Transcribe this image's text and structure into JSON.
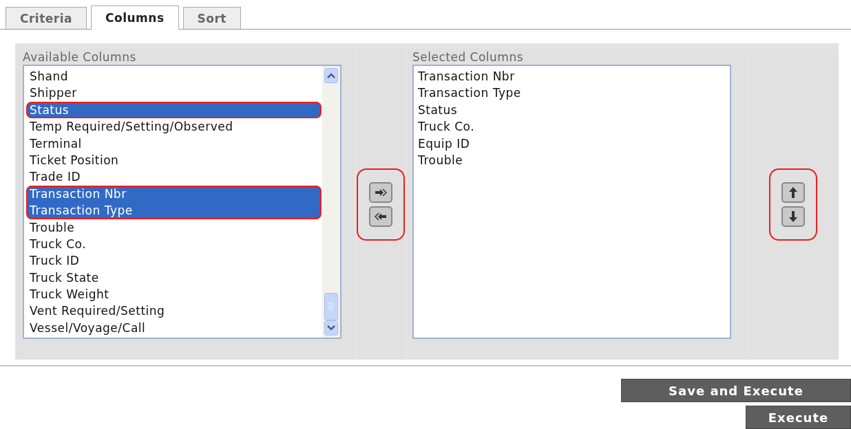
{
  "tabs": [
    {
      "label": "Criteria",
      "selected": false
    },
    {
      "label": "Columns",
      "selected": true
    },
    {
      "label": "Sort",
      "selected": false
    }
  ],
  "available": {
    "label": "Available Columns",
    "items": [
      {
        "label": "Shand",
        "selected": false,
        "circled": false
      },
      {
        "label": "Shipper",
        "selected": false,
        "circled": false
      },
      {
        "label": "Status",
        "selected": true,
        "circled": true
      },
      {
        "label": "Temp Required/Setting/Observed",
        "selected": false,
        "circled": false
      },
      {
        "label": "Terminal",
        "selected": false,
        "circled": false
      },
      {
        "label": "Ticket Position",
        "selected": false,
        "circled": false
      },
      {
        "label": "Trade ID",
        "selected": false,
        "circled": false
      },
      {
        "label": "Transaction Nbr",
        "selected": true,
        "circled": true
      },
      {
        "label": "Transaction Type",
        "selected": true,
        "circled": true
      },
      {
        "label": "Trouble",
        "selected": false,
        "circled": false
      },
      {
        "label": "Truck Co.",
        "selected": false,
        "circled": false
      },
      {
        "label": "Truck ID",
        "selected": false,
        "circled": false
      },
      {
        "label": "Truck State",
        "selected": false,
        "circled": false
      },
      {
        "label": "Truck Weight",
        "selected": false,
        "circled": false
      },
      {
        "label": "Vent Required/Setting",
        "selected": false,
        "circled": false
      },
      {
        "label": "Vessel/Voyage/Call",
        "selected": false,
        "circled": false
      }
    ]
  },
  "move_buttons": {
    "circled": true
  },
  "selected_columns": {
    "label": "Selected Columns",
    "items": [
      {
        "label": "Transaction Nbr",
        "selected": false
      },
      {
        "label": "Transaction Type",
        "selected": false
      },
      {
        "label": "Status",
        "selected": false
      },
      {
        "label": "Truck Co.",
        "selected": false
      },
      {
        "label": "Equip ID",
        "selected": false
      },
      {
        "label": "Trouble",
        "selected": false
      }
    ]
  },
  "order_buttons": {
    "circled": true
  },
  "buttons": [
    {
      "label": "Save and Execute"
    },
    {
      "label": "Execute"
    }
  ]
}
